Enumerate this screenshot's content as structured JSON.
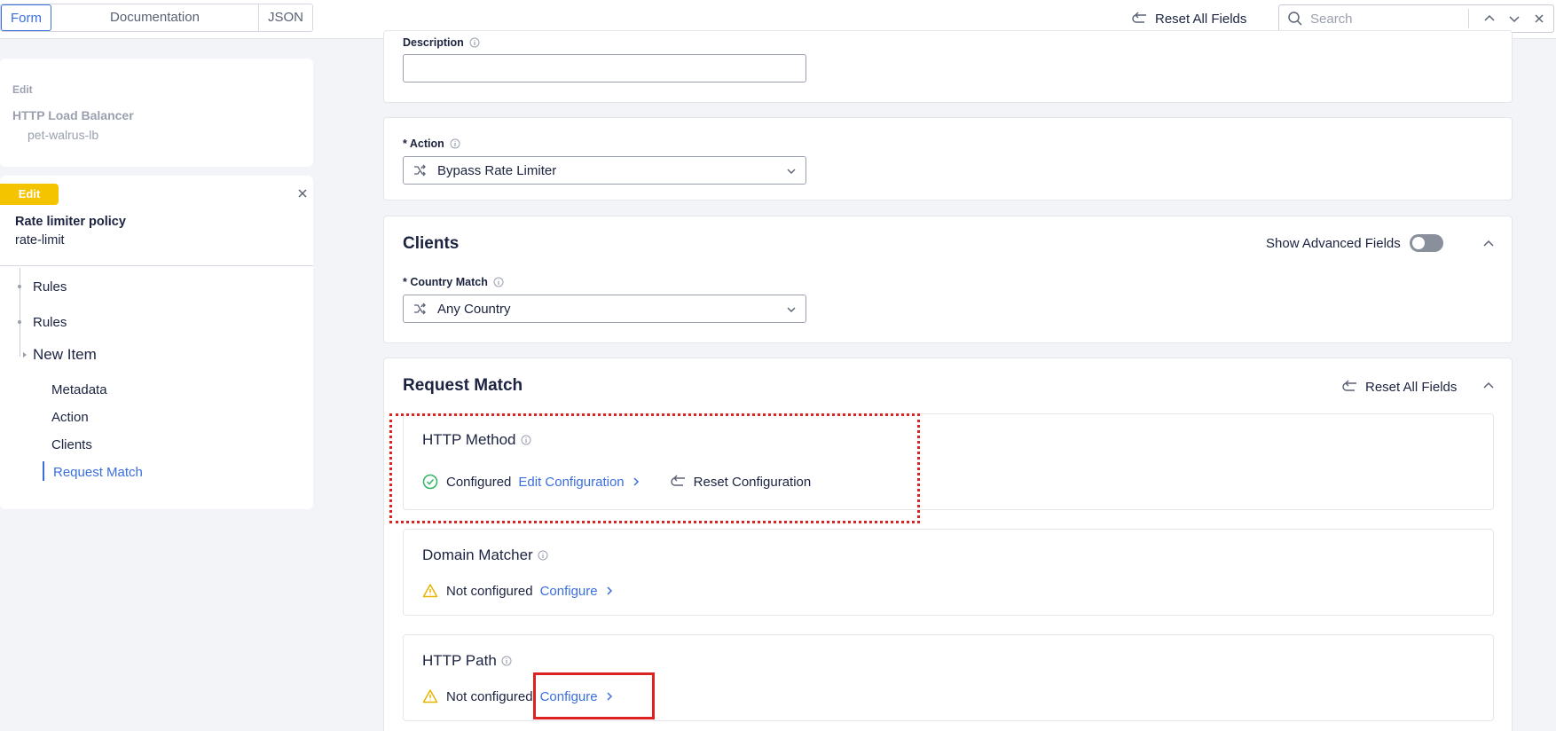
{
  "topbar": {
    "tabs": [
      "Form",
      "Documentation",
      "JSON"
    ],
    "active_tab": "Form",
    "reset_all_label": "Reset All Fields",
    "search_placeholder": "Search"
  },
  "sidebar": {
    "lb_card": {
      "edit_label": "Edit",
      "title": "HTTP Load Balancer",
      "subtitle": "pet-walrus-lb"
    },
    "policy_card": {
      "badge": "Edit",
      "title": "Rate limiter policy",
      "subtitle": "rate-limit",
      "nav": [
        {
          "label": "Rules"
        },
        {
          "label": "Rules"
        },
        {
          "label": "New Item"
        }
      ],
      "subnav": [
        {
          "label": "Metadata"
        },
        {
          "label": "Action"
        },
        {
          "label": "Clients"
        },
        {
          "label": "Request Match",
          "active": true
        }
      ]
    }
  },
  "main": {
    "description": {
      "label": "Description",
      "value": ""
    },
    "action": {
      "label": "* Action",
      "value": "Bypass Rate Limiter"
    },
    "clients": {
      "title": "Clients",
      "show_advanced_label": "Show Advanced Fields",
      "show_advanced_on": false,
      "country_label": "* Country Match",
      "country_value": "Any Country"
    },
    "request_match": {
      "title": "Request Match",
      "reset_label": "Reset All Fields",
      "items": [
        {
          "title": "HTTP Method",
          "status": "Configured",
          "link": "Edit Configuration",
          "reset": "Reset Configuration"
        },
        {
          "title": "Domain Matcher",
          "status": "Not configured",
          "link": "Configure"
        },
        {
          "title": "HTTP Path",
          "status": "Not configured",
          "link": "Configure"
        }
      ]
    }
  },
  "colors": {
    "accent": "#3b6fe0",
    "badge_yellow": "#f5c400",
    "success_green": "#2fb562",
    "warning_yellow": "#e8b400",
    "annotation_red": "#dd2222"
  }
}
